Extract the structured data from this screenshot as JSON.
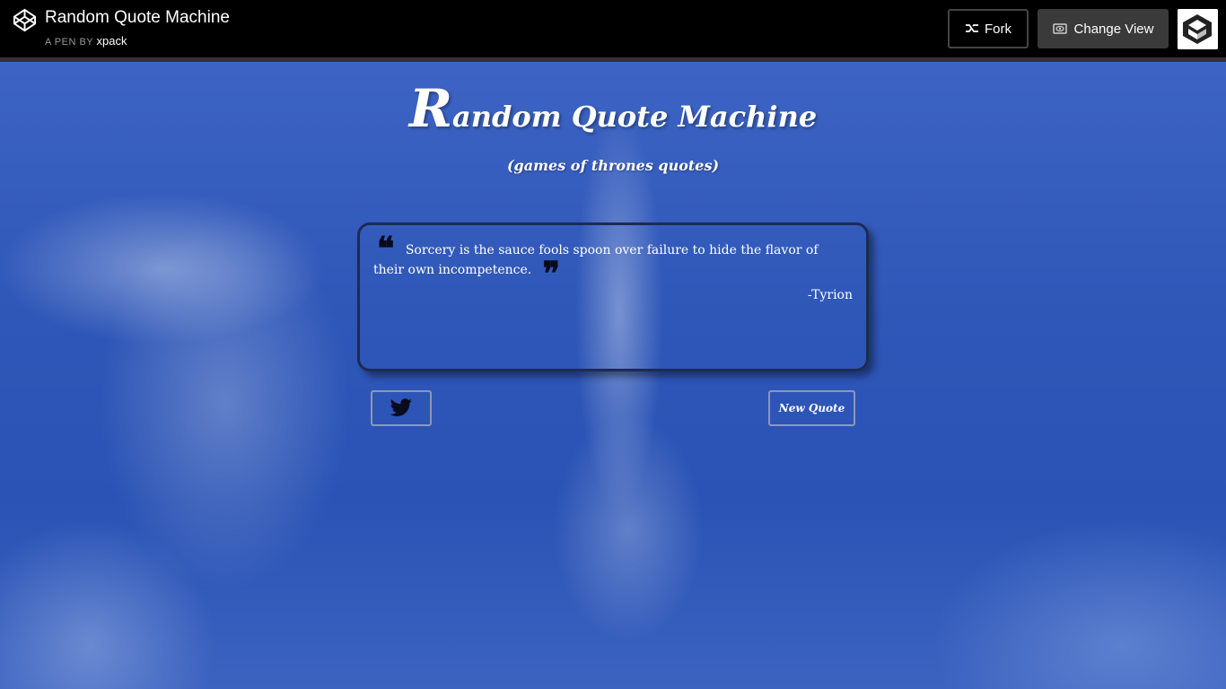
{
  "header": {
    "title": "Random Quote Machine",
    "pen_by_label": "A PEN BY",
    "author": "xpack",
    "fork_label": "Fork",
    "change_view_label": "Change View"
  },
  "app": {
    "title_first": "R",
    "title_rest": "andom Quote Machine",
    "subtitle": "(games of thrones quotes)",
    "quote": {
      "open_mark": "❝",
      "text": "Sorcery is the sauce fools spoon over failure to hide the flavor of their own incompetence.",
      "close_mark": "❞",
      "author": "-Tyrion"
    },
    "new_quote_label": "New Quote"
  },
  "icons": {
    "logo": "codepen-logo-icon",
    "fork": "fork-icon",
    "change_view": "eye-icon",
    "tweet": "twitter-bird-icon"
  },
  "colors": {
    "topbar": "#000000",
    "sky": "#2f57b8",
    "quote_border": "#1e2a55",
    "button_border": "#8c97b8"
  }
}
